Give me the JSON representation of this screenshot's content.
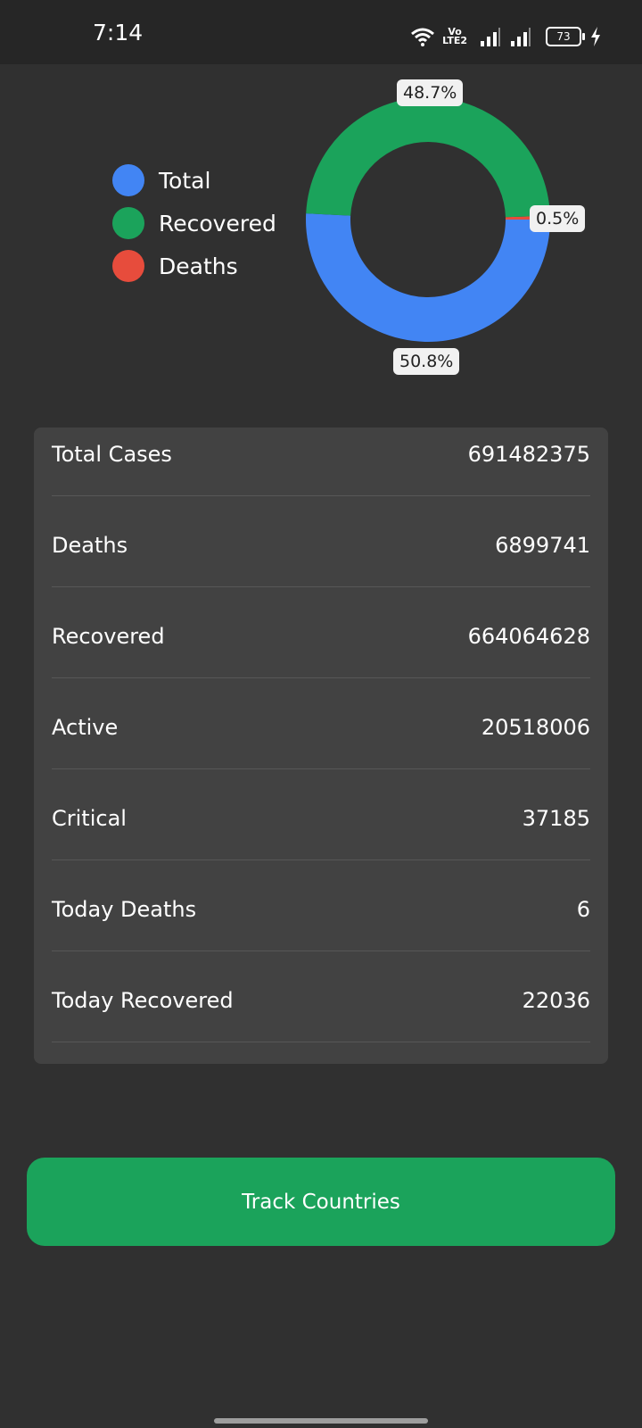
{
  "status_bar": {
    "time": "7:14",
    "network_label_top": "Vo",
    "network_label_bottom": "LTE2",
    "battery": "73"
  },
  "legend": [
    {
      "label": "Total",
      "color": "#4285f4"
    },
    {
      "label": "Recovered",
      "color": "#1ba35b"
    },
    {
      "label": "Deaths",
      "color": "#e74c3c"
    }
  ],
  "chart_data": {
    "type": "pie",
    "donut": true,
    "labels": [
      "Total",
      "Recovered",
      "Deaths"
    ],
    "values": [
      50.8,
      48.7,
      0.5
    ],
    "value_labels": [
      "50.8%",
      "48.7%",
      "0.5%"
    ],
    "colors": [
      "#4285f4",
      "#1ba35b",
      "#e74c3c"
    ],
    "legend_position": "left"
  },
  "stats": [
    {
      "label": "Total Cases",
      "value": "691482375"
    },
    {
      "label": "Deaths",
      "value": "6899741"
    },
    {
      "label": "Recovered",
      "value": "664064628"
    },
    {
      "label": "Active",
      "value": "20518006"
    },
    {
      "label": "Critical",
      "value": "37185"
    },
    {
      "label": "Today Deaths",
      "value": "6"
    },
    {
      "label": "Today Recovered",
      "value": "22036"
    }
  ],
  "track_button_label": "Track Countries"
}
